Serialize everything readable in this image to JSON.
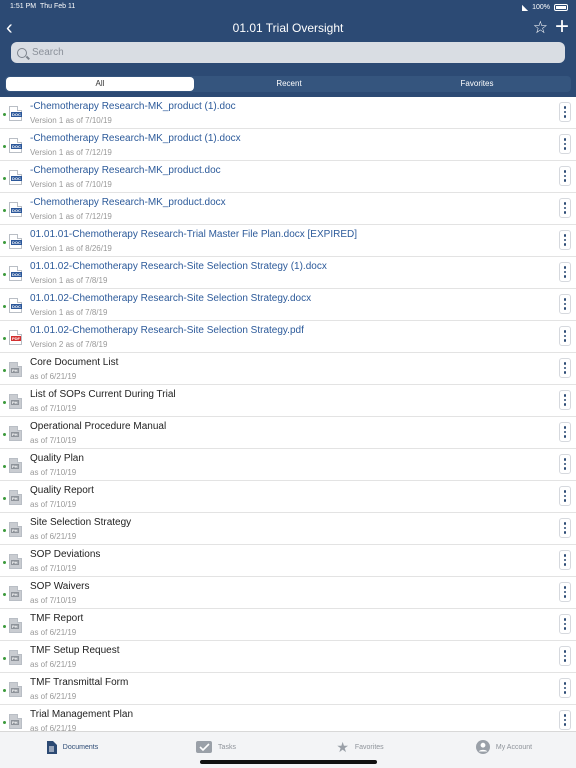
{
  "status": {
    "time": "1:51 PM",
    "date": "Thu Feb 11",
    "battery": "100%"
  },
  "nav": {
    "title": "01.01 Trial Oversight"
  },
  "search": {
    "placeholder": "Search"
  },
  "segments": [
    "All",
    "Recent",
    "Favorites"
  ],
  "rows": [
    {
      "name": "-Chemotherapy Research-MK_product (1).doc",
      "sub": "Version 1 as of 7/10/19",
      "type": "DOC",
      "link": true
    },
    {
      "name": "-Chemotherapy Research-MK_product (1).docx",
      "sub": "Version 1 as of 7/12/19",
      "type": "DOC",
      "link": true
    },
    {
      "name": "-Chemotherapy Research-MK_product.doc",
      "sub": "Version 1 as of 7/10/19",
      "type": "DOC",
      "link": true
    },
    {
      "name": "-Chemotherapy Research-MK_product.docx",
      "sub": "Version 1 as of 7/12/19",
      "type": "DOC",
      "link": true
    },
    {
      "name": "01.01.01-Chemotherapy Research-Trial Master File Plan.docx [EXPIRED]",
      "sub": "Version 1 as of 8/26/19",
      "type": "DOC",
      "link": true
    },
    {
      "name": "01.01.02-Chemotherapy Research-Site Selection Strategy (1).docx",
      "sub": "Version 1 as of 7/8/19",
      "type": "DOC",
      "link": true
    },
    {
      "name": "01.01.02-Chemotherapy Research-Site Selection Strategy.docx",
      "sub": "Version 1 as of 7/8/19",
      "type": "DOC",
      "link": true
    },
    {
      "name": "01.01.02-Chemotherapy Research-Site Selection Strategy.pdf",
      "sub": "Version 2 as of 7/8/19",
      "type": "PDF",
      "link": true
    },
    {
      "name": "Core Document List",
      "sub": "as of 6/21/19",
      "type": "PH",
      "link": false
    },
    {
      "name": "List of SOPs Current During Trial",
      "sub": "as of 7/10/19",
      "type": "PH",
      "link": false
    },
    {
      "name": "Operational Procedure Manual",
      "sub": "as of 7/10/19",
      "type": "PH",
      "link": false
    },
    {
      "name": "Quality Plan",
      "sub": "as of 7/10/19",
      "type": "PH",
      "link": false
    },
    {
      "name": "Quality Report",
      "sub": "as of 7/10/19",
      "type": "PH",
      "link": false
    },
    {
      "name": "Site Selection Strategy",
      "sub": "as of 6/21/19",
      "type": "PH",
      "link": false
    },
    {
      "name": "SOP Deviations",
      "sub": "as of 7/10/19",
      "type": "PH",
      "link": false
    },
    {
      "name": "SOP Waivers",
      "sub": "as of 7/10/19",
      "type": "PH",
      "link": false
    },
    {
      "name": "TMF Report",
      "sub": "as of 6/21/19",
      "type": "PH",
      "link": false
    },
    {
      "name": "TMF Setup Request",
      "sub": "as of 6/21/19",
      "type": "PH",
      "link": false
    },
    {
      "name": "TMF Transmittal Form",
      "sub": "as of 6/21/19",
      "type": "PH",
      "link": false
    },
    {
      "name": "Trial Management Plan",
      "sub": "as of 6/21/19",
      "type": "PH",
      "link": false
    }
  ],
  "tabs": [
    {
      "label": "Documents",
      "icon": "document-icon",
      "active": true
    },
    {
      "label": "Tasks",
      "icon": "tasks-icon",
      "active": false
    },
    {
      "label": "Favorites",
      "icon": "star-icon",
      "active": false
    },
    {
      "label": "My Account",
      "icon": "account-icon",
      "active": false
    }
  ]
}
